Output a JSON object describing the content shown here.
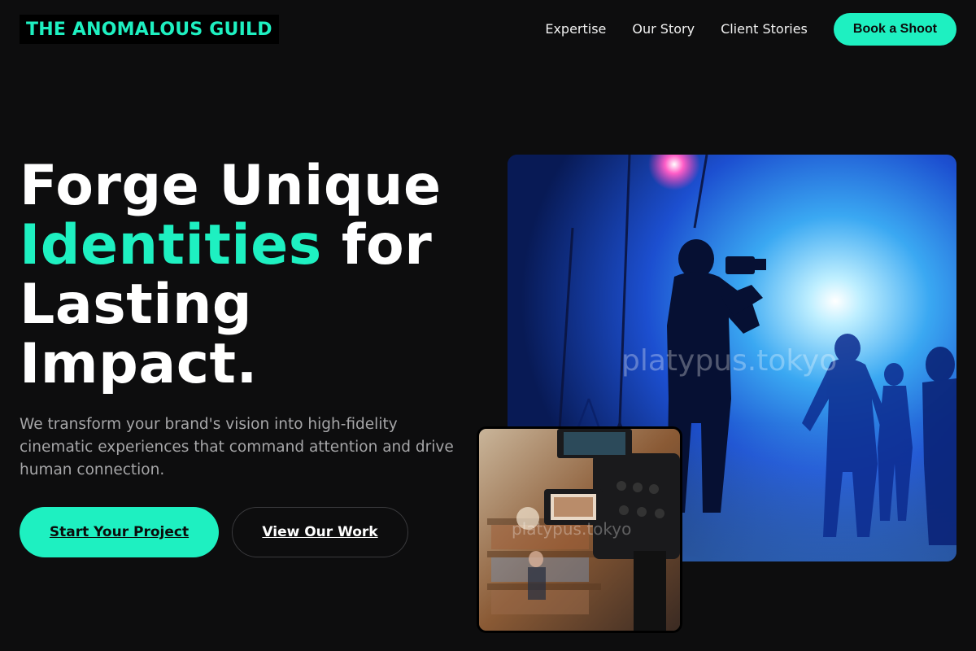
{
  "brand": {
    "name": "THE ANOMALOUS GUILD"
  },
  "nav": {
    "items": [
      {
        "label": "Expertise"
      },
      {
        "label": "Our Story"
      },
      {
        "label": "Client Stories"
      }
    ],
    "cta_label": "Book a Shoot"
  },
  "hero": {
    "headline_part1": "Forge Unique",
    "headline_accent": "Identities",
    "headline_part2": "for",
    "headline_part3": "Lasting",
    "headline_part4": "Impact.",
    "subtitle": "We transform your brand's vision into high-fidelity cinematic experiences that command attention and drive human connection.",
    "primary_cta": "Start Your Project",
    "secondary_cta": "View Our Work"
  },
  "media": {
    "main_watermark": "platypus.tokyo",
    "small_watermark": "platypus.tokyo"
  },
  "colors": {
    "background": "#0d0d0e",
    "accent": "#1ef0c1",
    "text": "#ffffff",
    "muted_text": "#a6a6a8"
  }
}
